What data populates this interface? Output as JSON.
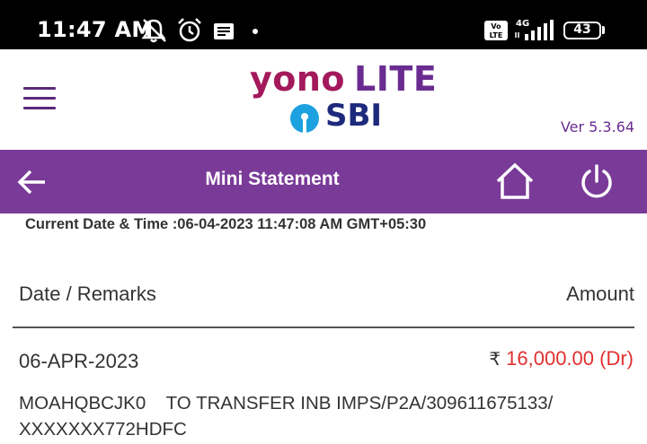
{
  "status_bar": {
    "time": "11:47 AM",
    "network": "4G",
    "volte": "Vo LTE",
    "battery": "43"
  },
  "header": {
    "logo_yono": "yono",
    "logo_lite": "LITE",
    "logo_sbi": "SBI",
    "version": "Ver 5.3.64"
  },
  "toolbar": {
    "title": "Mini Statement"
  },
  "statement": {
    "current_datetime": "Current Date & Time :06-04-2023 11:47:08 AM GMT+05:30",
    "col_date": "Date / Remarks",
    "col_amount": "Amount",
    "rows": [
      {
        "date": "06-APR-2023",
        "currency": "₹",
        "amount": "16,000.00 (Dr)",
        "remarks_line1": "MOAHQBCJK0    TO TRANSFER INB IMPS/P2A/309611675133/",
        "remarks_line2": "XXXXXXX772HDFC"
      }
    ]
  },
  "colors": {
    "brand_purple": "#7a3a98",
    "debit_red": "#e03030"
  }
}
